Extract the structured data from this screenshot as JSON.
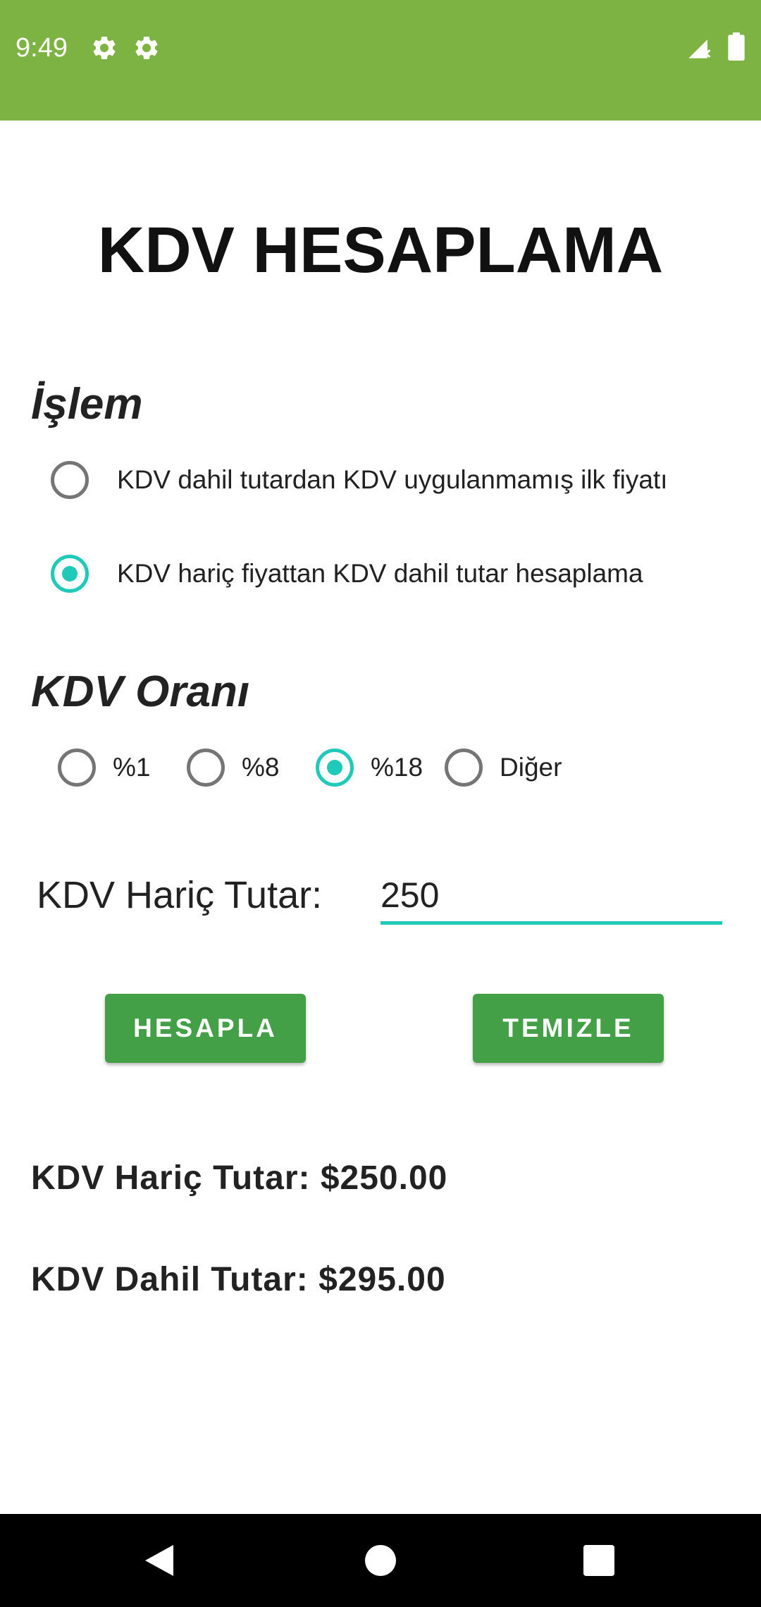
{
  "status_bar": {
    "time": "9:49",
    "color": "#7cb342",
    "icons": [
      "settings-gear-icon",
      "settings-gear-icon",
      "signal-icon",
      "battery-icon"
    ]
  },
  "app": {
    "title": "KDV HESAPLAMA"
  },
  "operation": {
    "title": "İşlem",
    "options": [
      {
        "label": "KDV dahil tutardan KDV uygulanmamış ilk fiyatı",
        "checked": false
      },
      {
        "label": "KDV hariç fiyattan KDV dahil tutar hesaplama",
        "checked": true
      }
    ]
  },
  "rate": {
    "title": "KDV Oranı",
    "options": [
      {
        "label": "%1",
        "checked": false
      },
      {
        "label": "%8",
        "checked": false
      },
      {
        "label": "%18",
        "checked": true
      },
      {
        "label": "Diğer",
        "checked": false
      }
    ]
  },
  "input": {
    "label": "KDV Hariç Tutar:",
    "value": "250"
  },
  "buttons": {
    "calculate": "HESAPLA",
    "clear": "TEMIZLE",
    "color": "#43a047"
  },
  "results": {
    "excluded": "KDV Hariç Tutar: $250.00",
    "included": "KDV Dahil Tutar: $295.00"
  },
  "accent_color": "#20c9b8",
  "nav_bar": {
    "icons": [
      "back-icon",
      "home-icon",
      "recents-icon"
    ]
  }
}
